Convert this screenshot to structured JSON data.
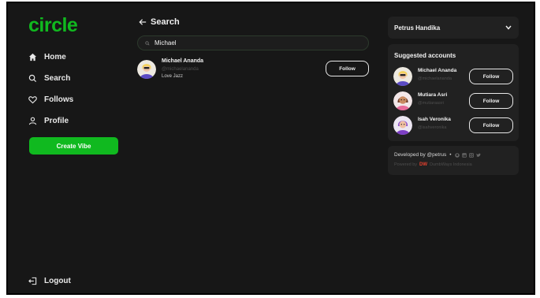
{
  "sidebar": {
    "logo": "circle",
    "nav": [
      {
        "label": "Home",
        "icon": "home-icon"
      },
      {
        "label": "Search",
        "icon": "search-icon"
      },
      {
        "label": "Follows",
        "icon": "heart-icon"
      },
      {
        "label": "Profile",
        "icon": "user-icon"
      }
    ],
    "create_button": "Create Vibe",
    "logout": "Logout"
  },
  "main": {
    "title": "Search",
    "search": {
      "value": "Michael",
      "icon": "search-icon"
    },
    "results": [
      {
        "name": "Michael Ananda",
        "handle": "@michaelananda",
        "bio": "Love Jazz",
        "button": "Follow"
      }
    ]
  },
  "right": {
    "user": {
      "name": "Petrus Handika",
      "icon": "chevron-down-icon"
    },
    "suggested_title": "Suggested accounts",
    "suggested": [
      {
        "name": "Michael Ananda",
        "handle": "@michaelananda",
        "button": "Follow"
      },
      {
        "name": "Mutiara Asri",
        "handle": "@mutiaraasri",
        "button": "Follow"
      },
      {
        "name": "Isah Veronika",
        "handle": "@isahveronika",
        "button": "Follow"
      }
    ],
    "footer": {
      "developed_by": "Developed by @petrus",
      "separator": "•",
      "social_icons": [
        "github-icon",
        "linkedin-icon",
        "instagram-icon",
        "twitter-icon"
      ],
      "powered_by": "Powered by",
      "powered_logo": "DW",
      "powered_name": "DumbWays Indonesia"
    }
  },
  "colors": {
    "accent": "#10b91f",
    "background": "#171717",
    "card": "#212121"
  }
}
